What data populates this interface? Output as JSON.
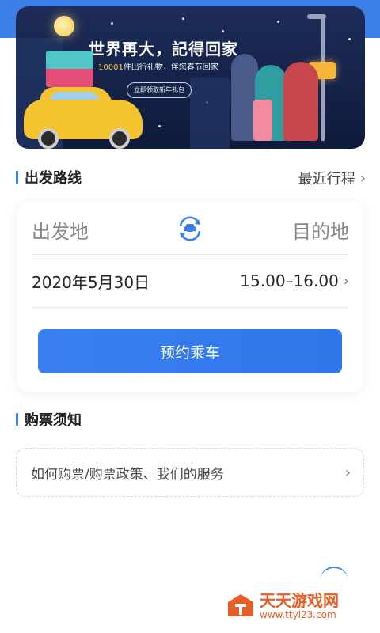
{
  "banner": {
    "title": "世界再大，記得回家",
    "subtitle_number": "10001",
    "subtitle_rest": "件出行礼物，伴您春节回家",
    "cta_label": "立即领取新年礼包"
  },
  "route_section": {
    "title": "出发路线",
    "recent_link": "最近行程"
  },
  "route_card": {
    "from_placeholder": "出发地",
    "to_placeholder": "目的地",
    "date": "2020年5月30日",
    "time_range": "15.00–16.00",
    "book_button": "预约乘车"
  },
  "notice_section": {
    "title": "购票须知",
    "item": "如何购票/购票政策、我们的服务"
  },
  "watermark": {
    "name": "天天游戏网",
    "url": "www.ttyl23.com"
  },
  "colors": {
    "accent": "#3c7fe9",
    "button": "#2f77ea",
    "watermark": "#e85c26"
  }
}
